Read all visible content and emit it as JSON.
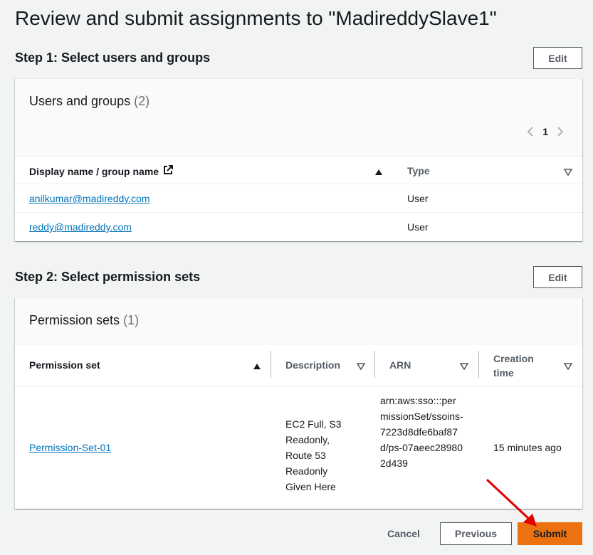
{
  "page": {
    "title": "Review and submit assignments to \"MadireddySlave1\""
  },
  "step1": {
    "title": "Step 1: Select users and groups",
    "edit_label": "Edit",
    "card_title": "Users and groups",
    "count": "(2)",
    "pagination": {
      "current_page": "1"
    },
    "columns": [
      "Display name / group name",
      "Type"
    ],
    "rows": [
      {
        "name": "anilkumar@madireddy.com",
        "type": "User"
      },
      {
        "name": "reddy@madireddy.com",
        "type": "User"
      }
    ]
  },
  "step2": {
    "title": "Step 2: Select permission sets",
    "edit_label": "Edit",
    "card_title": "Permission sets",
    "count": "(1)",
    "columns": [
      "Permission set",
      "Description",
      "ARN",
      "Creation time"
    ],
    "rows": [
      {
        "name": "Permission-Set-01",
        "description": "EC2 Full, S3 Readonly, Route 53 Readonly Given Here",
        "arn": "arn:aws:sso:::permissionSet/ssoins-7223d8dfe6baf87d/ps-07aeec289802d439",
        "creation_time": "15 minutes ago"
      }
    ]
  },
  "footer": {
    "cancel_label": "Cancel",
    "previous_label": "Previous",
    "submit_label": "Submit"
  },
  "colors": {
    "link": "#0073bb",
    "primary": "#ec7211",
    "annotation_arrow": "#e00000"
  },
  "icons": {
    "external_link": "external-link-icon",
    "sort_asc": "sort-ascending-icon",
    "sort_desc": "sort-descending-icon",
    "prev_page": "chevron-left-icon",
    "next_page": "chevron-right-icon"
  }
}
